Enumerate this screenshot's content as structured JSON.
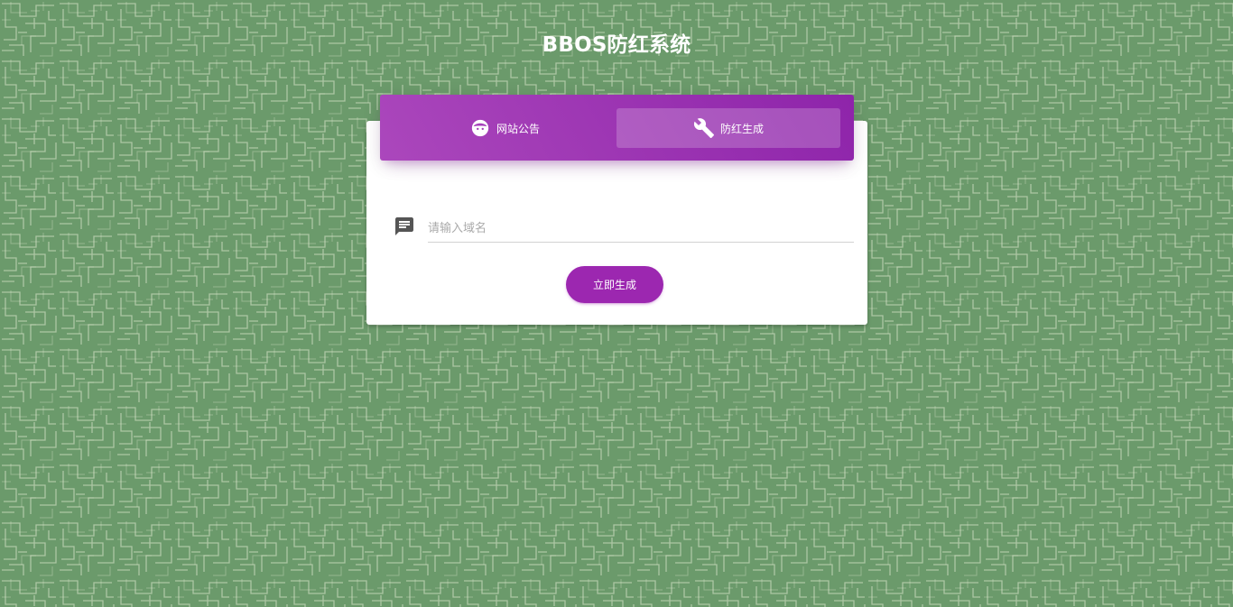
{
  "page": {
    "title": "BBOS防红系统"
  },
  "tabs": [
    {
      "label": "网站公告",
      "icon": "face-icon",
      "active": false
    },
    {
      "label": "防红生成",
      "icon": "wrench-icon",
      "active": true
    }
  ],
  "form": {
    "input_icon": "chat-icon",
    "domain_placeholder": "请输入域名",
    "domain_value": "",
    "submit_label": "立即生成"
  },
  "colors": {
    "background": "#6b9a6b",
    "accent": "#9c27b0",
    "card": "#ffffff"
  }
}
